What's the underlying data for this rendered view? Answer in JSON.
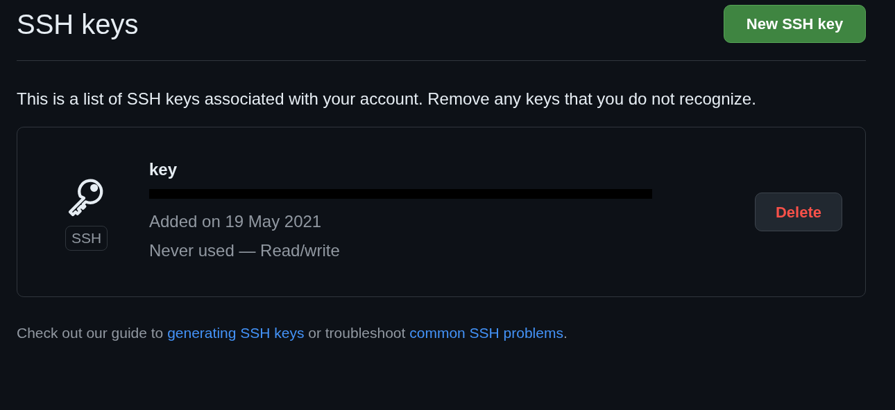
{
  "header": {
    "title": "SSH keys",
    "new_button": "New SSH key"
  },
  "intro": "This is a list of SSH keys associated with your account. Remove any keys that you do not recognize.",
  "keys": [
    {
      "badge": "SSH",
      "name": "key",
      "added": "Added on 19 May 2021",
      "usage": "Never used — Read/write",
      "delete_button": "Delete"
    }
  ],
  "footer": {
    "before": "Check out our guide to",
    "link1": "generating SSH keys",
    "middle": "or troubleshoot",
    "link2": "common SSH problems",
    "after": "."
  }
}
